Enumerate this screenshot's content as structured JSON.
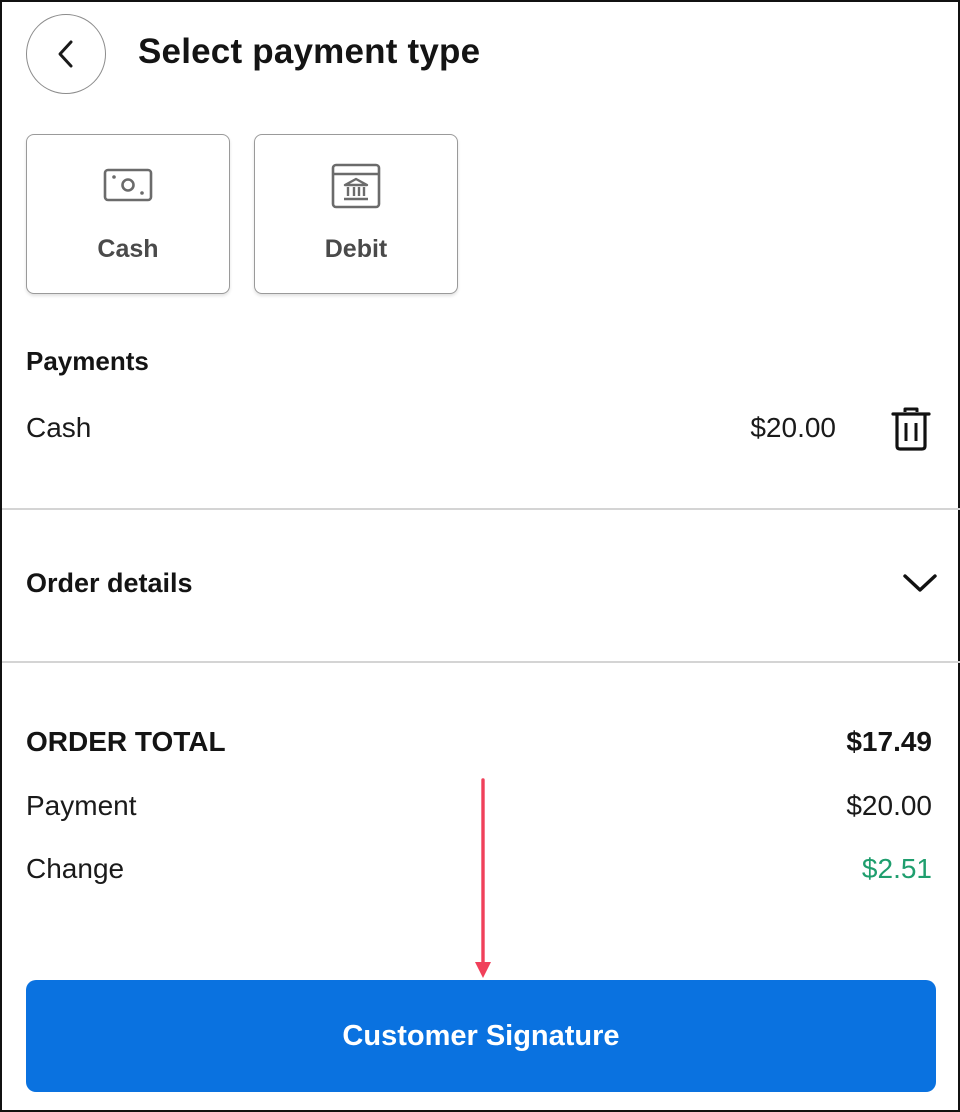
{
  "header": {
    "title": "Select payment type",
    "back_icon": "chevron-left-icon"
  },
  "payment_types": [
    {
      "label": "Cash",
      "icon": "cash-icon"
    },
    {
      "label": "Debit",
      "icon": "bank-icon"
    }
  ],
  "payments": {
    "section_title": "Payments",
    "items": [
      {
        "name": "Cash",
        "amount": "$20.00",
        "action_icon": "trash-icon"
      }
    ]
  },
  "order_details": {
    "title": "Order details",
    "toggle_icon": "chevron-down-icon"
  },
  "summary": {
    "total_label": "ORDER TOTAL",
    "total_value": "$17.49",
    "payment_label": "Payment",
    "payment_value": "$20.00",
    "change_label": "Change",
    "change_value": "$2.51",
    "change_color": "#1f9e6e"
  },
  "cta": {
    "label": "Customer Signature",
    "color": "#0a72e0"
  },
  "annotation": {
    "arrow_color": "#f0405a"
  }
}
